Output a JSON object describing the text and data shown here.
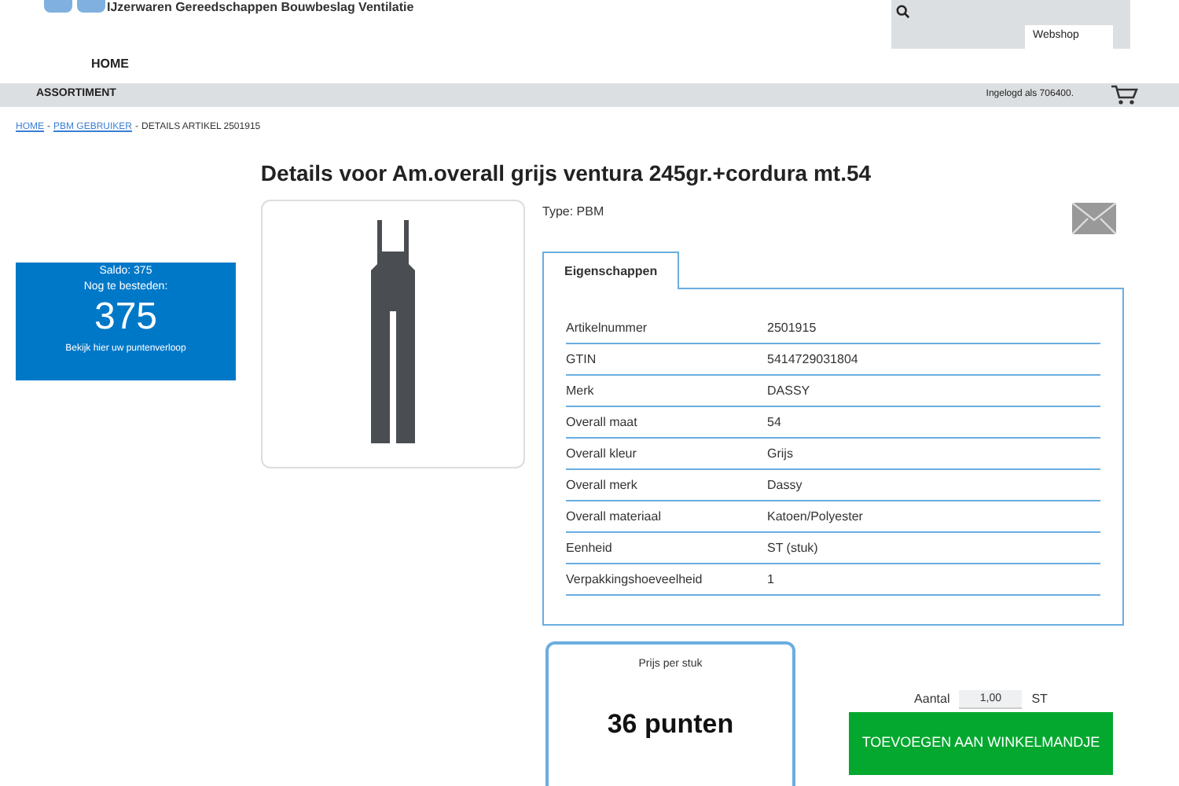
{
  "header": {
    "tagline": "IJzerwaren Gereedschappen Bouwbeslag Ventilatie",
    "webshop_button": "Webshop",
    "nav": [
      "HOME"
    ]
  },
  "menu_bar": {
    "item": "ASSORTIMENT",
    "login": "Ingelogd als 706400."
  },
  "breadcrumb_separator": "-",
  "breadcrumb": [
    {
      "label": "HOME",
      "link": true
    },
    {
      "label": "PBM GEBRUIKER",
      "link": true
    },
    {
      "label": "DETAILS ARTIKEL 2501915",
      "link": false
    }
  ],
  "title": "Details voor Am.overall grijs ventura 245gr.+cordura mt.54",
  "balance": {
    "saldo": "Saldo: 375",
    "remaining_label": "Nog te besteden:",
    "remaining": "375",
    "link": "Bekijk hier uw puntenverloop"
  },
  "type": "Type: PBM",
  "tabs": [
    {
      "label": "Eigenschappen",
      "selected": true
    }
  ],
  "properties": [
    {
      "name": "Artikelnummer",
      "value": "2501915"
    },
    {
      "name": "GTIN",
      "value": "5414729031804"
    },
    {
      "name": "Merk",
      "value": "DASSY"
    },
    {
      "name": "Overall maat",
      "value": "54"
    },
    {
      "name": "Overall kleur",
      "value": "Grijs"
    },
    {
      "name": "Overall merk",
      "value": "Dassy"
    },
    {
      "name": "Overall materiaal",
      "value": "Katoen/Polyester"
    },
    {
      "name": "Eenheid",
      "value": "ST (stuk)"
    },
    {
      "name": "Verpakkingshoeveelheid",
      "value": "1"
    }
  ],
  "price": {
    "label": "Prijs per stuk",
    "value": "36 punten"
  },
  "order": {
    "quantity_label": "Aantal",
    "quantity": "1,00",
    "unit": "ST",
    "add_button": "TOEVOEGEN AAN WINKELMANDJE"
  }
}
